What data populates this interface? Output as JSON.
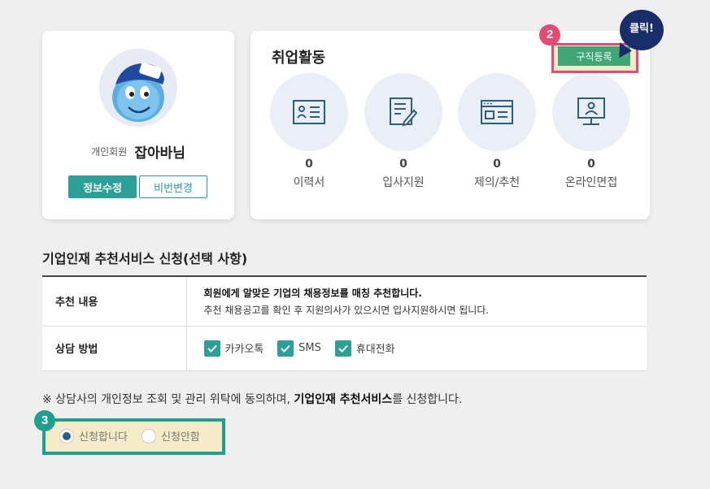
{
  "profile": {
    "member_type": "개인회원",
    "member_name": "잡아바님",
    "edit_label": "정보수정",
    "password_label": "비번변경"
  },
  "activity": {
    "title": "취업활동",
    "register_label": "구직등록",
    "step_badge": "2",
    "click_callout": "클릭!",
    "items": [
      {
        "count": "0",
        "label": "이력서",
        "icon": "resume-icon"
      },
      {
        "count": "0",
        "label": "입사지원",
        "icon": "apply-icon"
      },
      {
        "count": "0",
        "label": "제의/추천",
        "icon": "offer-icon"
      },
      {
        "count": "0",
        "label": "온라인면접",
        "icon": "online-interview-icon"
      }
    ]
  },
  "recommend": {
    "title": "기업인재 추천서비스 신청(선택 사항)",
    "rows": [
      {
        "label": "추천 내용",
        "line1": "회원에게 알맞은 기업의 채용정보를 매칭 추천합니다.",
        "line2": "추천 채용공고를 확인 후 지원의사가 있으시면 입사지원하시면 됩니다."
      },
      {
        "label": "상담 방법",
        "options": [
          "카카오톡",
          "SMS",
          "휴대전화"
        ]
      }
    ]
  },
  "notice": {
    "prefix": "※ 상담사의 개인정보 조회 및 관리 위탁에 동의하며, ",
    "strong": "기업인재 추천서비스",
    "suffix": "를 신청합니다."
  },
  "apply": {
    "step_badge": "3",
    "options": [
      "신청합니다",
      "신청안함"
    ],
    "selected": "신청합니다"
  },
  "colors": {
    "teal": "#2aa096",
    "green": "#3fa676",
    "pink": "#e54a72",
    "navy": "#1a2d6b",
    "highlight": "#f3ebc7"
  }
}
